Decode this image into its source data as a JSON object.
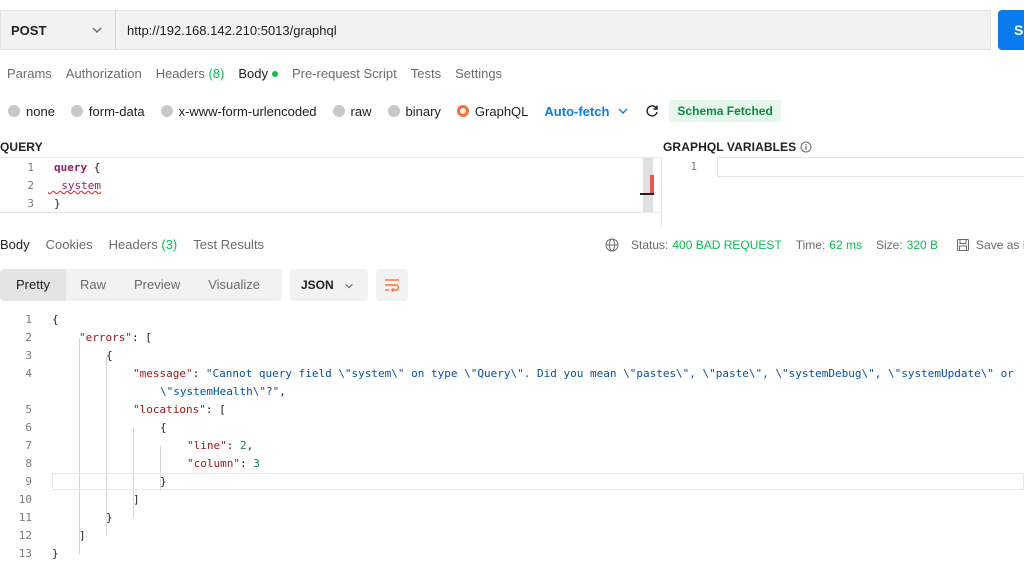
{
  "request": {
    "method": "POST",
    "url": "http://192.168.142.210:5013/graphql",
    "send_label": "S"
  },
  "request_tabs": [
    {
      "label": "Params",
      "active": false
    },
    {
      "label": "Authorization",
      "active": false
    },
    {
      "label": "Headers",
      "count": "(8)",
      "active": false
    },
    {
      "label": "Body",
      "active": true
    },
    {
      "label": "Pre-request Script",
      "active": false
    },
    {
      "label": "Tests",
      "active": false
    },
    {
      "label": "Settings",
      "active": false
    }
  ],
  "body_types": [
    {
      "label": "none",
      "selected": false
    },
    {
      "label": "form-data",
      "selected": false
    },
    {
      "label": "x-www-form-urlencoded",
      "selected": false
    },
    {
      "label": "raw",
      "selected": false
    },
    {
      "label": "binary",
      "selected": false
    },
    {
      "label": "GraphQL",
      "selected": true
    }
  ],
  "autofetch_label": "Auto-fetch",
  "schema_status": "Schema Fetched",
  "query_pane": {
    "title": "QUERY",
    "lines": [
      {
        "n": "1",
        "keyword": "query",
        "rest": " {"
      },
      {
        "n": "2",
        "field": "system"
      },
      {
        "n": "3",
        "rest": "}"
      }
    ]
  },
  "variables_pane": {
    "title": "GRAPHQL VARIABLES",
    "line": "1"
  },
  "response_tabs": [
    {
      "label": "Body",
      "active": true
    },
    {
      "label": "Cookies",
      "active": false
    },
    {
      "label": "Headers",
      "count": "(3)",
      "active": false
    },
    {
      "label": "Test Results",
      "active": false
    }
  ],
  "response_meta": {
    "status_label": "Status:",
    "status_value": "400 BAD REQUEST",
    "time_label": "Time:",
    "time_value": "62 ms",
    "size_label": "Size:",
    "size_value": "320 B",
    "save_label": "Save as Ex"
  },
  "view_modes": [
    "Pretty",
    "Raw",
    "Preview",
    "Visualize"
  ],
  "response_format": "JSON",
  "response_lines": [
    {
      "n": "1",
      "indent": 0,
      "parts": [
        [
          "p",
          "{"
        ]
      ]
    },
    {
      "n": "2",
      "indent": 1,
      "parts": [
        [
          "k",
          "\"errors\""
        ],
        [
          "p",
          ": ["
        ]
      ]
    },
    {
      "n": "3",
      "indent": 2,
      "parts": [
        [
          "p",
          "{"
        ]
      ]
    },
    {
      "n": "4",
      "indent": 3,
      "parts": [
        [
          "k",
          "\"message\""
        ],
        [
          "p",
          ": "
        ],
        [
          "s",
          "\"Cannot query field \\\"system\\\" on type \\\"Query\\\". Did you mean \\\"pastes\\\", \\\"paste\\\", \\\"systemDebug\\\", \\\"systemUpdate\\\" or"
        ]
      ]
    },
    {
      "n": "",
      "indent": 4,
      "parts": [
        [
          "s",
          "\\\"systemHealth\\\"?\""
        ],
        [
          "p",
          ","
        ]
      ]
    },
    {
      "n": "5",
      "indent": 3,
      "parts": [
        [
          "k",
          "\"locations\""
        ],
        [
          "p",
          ": ["
        ]
      ]
    },
    {
      "n": "6",
      "indent": 4,
      "parts": [
        [
          "p",
          "{"
        ]
      ]
    },
    {
      "n": "7",
      "indent": 5,
      "parts": [
        [
          "k",
          "\"line\""
        ],
        [
          "p",
          ": "
        ],
        [
          "n",
          "2"
        ],
        [
          "p",
          ","
        ]
      ]
    },
    {
      "n": "8",
      "indent": 5,
      "parts": [
        [
          "k",
          "\"column\""
        ],
        [
          "p",
          ": "
        ],
        [
          "n",
          "3"
        ]
      ]
    },
    {
      "n": "9",
      "indent": 4,
      "parts": [
        [
          "p",
          "}"
        ]
      ]
    },
    {
      "n": "10",
      "indent": 3,
      "parts": [
        [
          "p",
          "]"
        ]
      ]
    },
    {
      "n": "11",
      "indent": 2,
      "parts": [
        [
          "p",
          "}"
        ]
      ]
    },
    {
      "n": "12",
      "indent": 1,
      "parts": [
        [
          "p",
          "]"
        ]
      ]
    },
    {
      "n": "13",
      "indent": 0,
      "parts": [
        [
          "p",
          "}"
        ]
      ]
    }
  ],
  "colors": {
    "accent_blue": "#097bed",
    "status_green": "#0cbb52",
    "graphql_orange": "#ff6c37",
    "json_key": "#a31515",
    "json_string": "#0451a5",
    "json_number": "#098658"
  }
}
